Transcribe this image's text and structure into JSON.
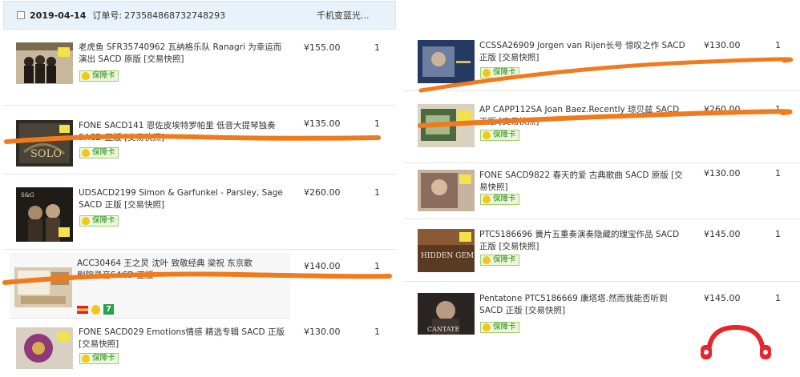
{
  "order": {
    "date": "2019-04-14",
    "number_label": "订单号:",
    "number": "273584868732748293",
    "shop": "千机变蓝光..."
  },
  "badge_label": "保障卡",
  "left_items": [
    {
      "title": "老虎鱼 SFR35740962 瓦纳格乐队 Ranagri 为幸运而演出 SACD 原版 [交易快照]",
      "price": "¥155.00",
      "qty": "1",
      "cover": "quartet-cover"
    },
    {
      "title": "FONE SACD141 恩佐皮埃特罗帕里 低音大提琴独奏 SACD 正版 [交易快照]",
      "price": "¥135.00",
      "qty": "1",
      "cover": "solo-cover"
    },
    {
      "title": "UDSACD2199 Simon & Garfunkel - Parsley, Sage SACD 正版 [交易快照]",
      "price": "¥260.00",
      "qty": "1",
      "cover": "duo-cover"
    },
    {
      "title": "ACC30464 王之炅 沈叶 致敬经典 梁祝 东京歌剧院录音SACD 正版",
      "price": "¥140.00",
      "qty": "1",
      "cover": "package-cover"
    },
    {
      "title": "FONE SACD029 Emotions情感 精选专辑 SACD 正版 [交易快照]",
      "price": "¥130.00",
      "qty": "1",
      "cover": "emotions-cover"
    }
  ],
  "right_items": [
    {
      "title": "CCSSA26909 Jorgen van Rijen长号 惊叹之作 SACD 正版 [交易快照]",
      "price": "¥130.00",
      "qty": "1",
      "cover": "trombone-cover"
    },
    {
      "title": "AP CAPP112SA Joan Baez.Recently 琼贝兹 SACD 正版 [交易快照]",
      "price": "¥260.00",
      "qty": "1",
      "cover": "baez-cover"
    },
    {
      "title": "FONE SACD9822 春天的爱 古典歌曲 SACD 原版 [交易快照]",
      "price": "¥130.00",
      "qty": "1",
      "cover": "spring-cover"
    },
    {
      "title": "PTC5186696 簧片五重奏演奏隐藏的瑰宝作品 SACD 正版 [交易快照]",
      "price": "¥145.00",
      "qty": "1",
      "cover": "hidden-gems-cover"
    },
    {
      "title": "Pentatone PTC5186669 康塔塔.然而我能否听到 SACD 正版 [交易快照]",
      "price": "¥145.00",
      "qty": "1",
      "cover": "cantata-cover"
    }
  ],
  "cover_text": {
    "solo": "SOLO",
    "hidden_gems": "HIDDEN GEMS",
    "cantata": "CANTATE"
  },
  "colors": {
    "header_bg": "#e8f2fb",
    "redaction_stroke": "#f07a1c",
    "logo_red": "#e5262c",
    "badge_green": "#2a8a1a"
  }
}
